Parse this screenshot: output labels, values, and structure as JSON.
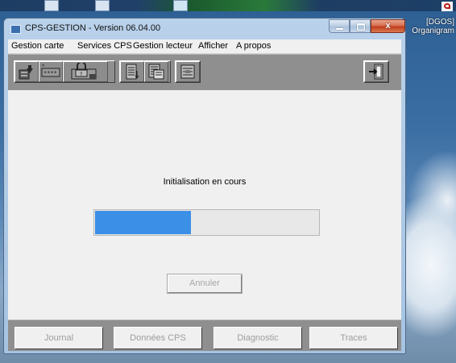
{
  "desktop": {
    "right_label_line1": "[DGOS]",
    "right_label_line2": "Organigram"
  },
  "window": {
    "title": "CPS-GESTION - Version 06.04.00",
    "close_glyph": "x"
  },
  "menu": [
    "Gestion carte",
    "Services CPS",
    "Gestion lecteur",
    "Afficher",
    "A propos"
  ],
  "toolbar": {
    "icons": [
      "card-info-icon",
      "pin-code-icon",
      "unlock-card-icon",
      "list-icon",
      "card-data-icon",
      "reader-icon",
      "exit-icon"
    ]
  },
  "main": {
    "status": "Initialisation en cours",
    "progress_fraction": 0.43,
    "progress_color": "#3c8fe6",
    "cancel_label": "Annuler"
  },
  "bottom_tabs": [
    "Journal",
    "Données CPS",
    "Diagnostic",
    "Traces"
  ]
}
